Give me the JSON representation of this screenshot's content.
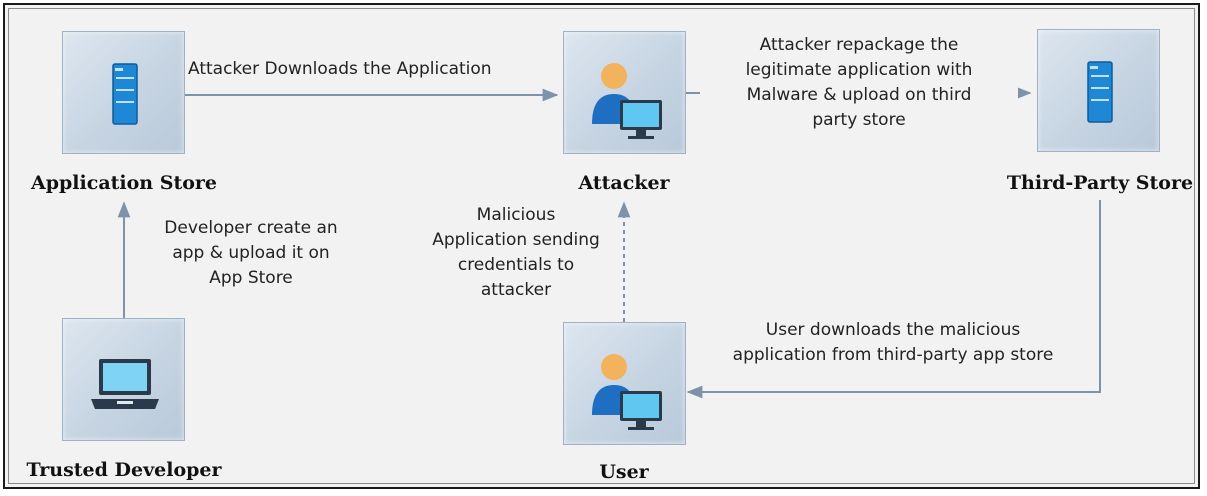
{
  "nodes": {
    "application_store": {
      "title": "Application Store"
    },
    "attacker": {
      "title": "Attacker"
    },
    "third_party_store": {
      "title": "Third-Party Store"
    },
    "trusted_developer": {
      "title": "Trusted Developer"
    },
    "user": {
      "title": "User"
    }
  },
  "edges": {
    "downloads": {
      "label": "Attacker Downloads the Application"
    },
    "repackage": {
      "lines": [
        "Attacker repackage the",
        "legitimate application with",
        "Malware & upload on third",
        "party store"
      ]
    },
    "developer": {
      "lines": [
        "Developer create an",
        "app & upload it on",
        "App Store"
      ]
    },
    "malicious": {
      "lines": [
        "Malicious",
        "Application sending",
        "credentials to",
        "attacker"
      ]
    },
    "user_downloads": {
      "lines": [
        "User downloads the malicious",
        "application from third-party app store"
      ]
    }
  },
  "icons": {
    "application_store": "server-icon",
    "third_party_store": "server-icon",
    "attacker": "user-computer-icon",
    "user": "user-computer-icon",
    "trusted_developer": "laptop-icon"
  },
  "colors": {
    "arrow": "#7d93ab",
    "node_fill": "#c6d4e2",
    "server_blue": "#1e88d6"
  }
}
